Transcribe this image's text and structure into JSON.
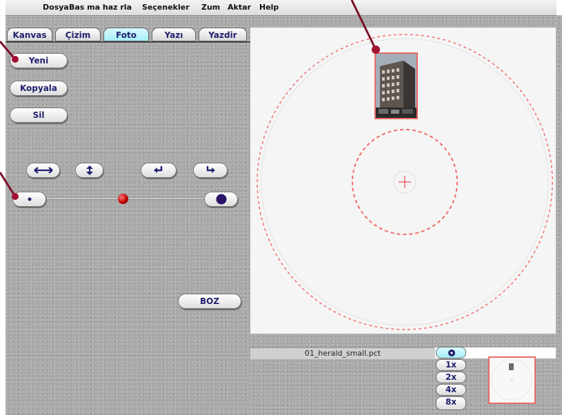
{
  "menubar": {
    "items": [
      "Dosya",
      "Bas ma haz rla",
      "Seçenekler",
      "Zum",
      "Aktar",
      "Help"
    ]
  },
  "tabs": [
    {
      "label": "Kanvas",
      "active": false
    },
    {
      "label": "Çizim",
      "active": false
    },
    {
      "label": "Foto",
      "active": true
    },
    {
      "label": "Yazı",
      "active": false
    },
    {
      "label": "Yazdir",
      "active": false
    }
  ],
  "photo_tools": {
    "new_label": "Yeni",
    "copy_label": "Kopyala",
    "delete_label": "Sil",
    "flip_horizontal_icon": "flip-horizontal-icon",
    "flip_vertical_icon": "flip-vertical-icon",
    "rotate_left_icon": "rotate-left-icon",
    "rotate_right_icon": "rotate-right-icon",
    "size_slider": {
      "min_icon": "small-dot-icon",
      "max_icon": "large-dot-icon",
      "value": 0.47
    },
    "reset_label": "BOZ"
  },
  "canvas": {
    "center_marker_icon": "crosshair-icon",
    "guide_color": "#f26b6b"
  },
  "status": {
    "filename": "01_herald_small.pct"
  },
  "zoom": {
    "fit_icon": "fit-dot-icon",
    "levels": [
      "1x",
      "2x",
      "4x",
      "8x"
    ],
    "active": "fit"
  },
  "colors": {
    "accent_tab": "#a6eef6",
    "label_text": "#1f1f6e",
    "callout": "#a31232",
    "selection_border": "#e86a6a"
  }
}
